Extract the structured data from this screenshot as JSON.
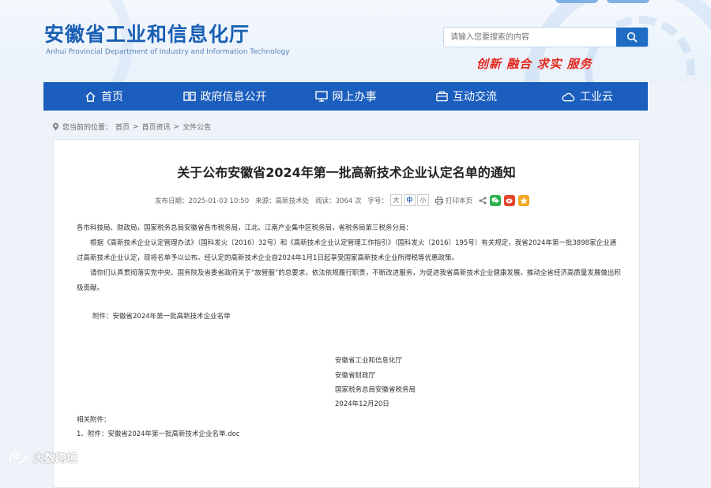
{
  "header": {
    "title_zh": "安徽省工业和信息化厅",
    "title_en": "Anhui Provincial Department of Industry and Information Technology",
    "search_placeholder": "请输入您要搜索的内容",
    "slogan": "创新  融合  求实  服务",
    "brand_color": "#1c5ebd"
  },
  "nav": {
    "items": [
      {
        "label": "首页",
        "icon": "home-icon"
      },
      {
        "label": "政府信息公开",
        "icon": "book-icon"
      },
      {
        "label": "网上办事",
        "icon": "monitor-icon"
      },
      {
        "label": "互动交流",
        "icon": "chat-icon"
      },
      {
        "label": "工业云",
        "icon": "cloud-icon"
      }
    ]
  },
  "breadcrumb": {
    "prefix": "您当前的位置：",
    "items": [
      "首页",
      "首页资讯",
      "文件公告"
    ],
    "sep": ">"
  },
  "article": {
    "title": "关于公布安徽省2024年第一批高新技术企业认定名单的通知",
    "publish": "发布日期：2025-01-03 10:50",
    "source": "来源：高新技术处",
    "views": "阅读：3064 次",
    "font_label": "字号：",
    "font_sizes": [
      "大",
      "中",
      "小"
    ],
    "print": "打印本页",
    "addressee": "各市科技局、财政局，国家税务总局安徽省各市税务局，江北、江南产业集中区税务局，省税务局第三税务分局：",
    "para1": "根据《高新技术企业认定管理办法》（国科发火〔2016〕32号）和《高新技术企业认定管理工作指引》（国科发火〔2016〕195号）有关规定，我省2024年第一批3898家企业通过高新技术企业认定，现将名单予以公布。经认定的高新技术企业自2024年1月1日起享受国家高新技术企业所得税等优惠政策。",
    "para2": "请你们认真贯彻落实党中央、国务院及省委省政府关于“放管服”的总要求，依法依规履行职责，不断改进服务，为促进我省高新技术企业健康发展，推动全省经济高质量发展做出积极贡献。",
    "attachment_line": "附件：安徽省2024年第一批高新技术企业名单",
    "signatures": [
      "安徽省工业和信息化厅",
      "安徽省财政厅",
      "国家税务总局安徽省税务局",
      "2024年12月20日"
    ],
    "related_label": "相关附件：",
    "related_file": "1、附件：安徽省2024年第一批高新技术企业名单.doc"
  },
  "watermark": "大数跨境"
}
